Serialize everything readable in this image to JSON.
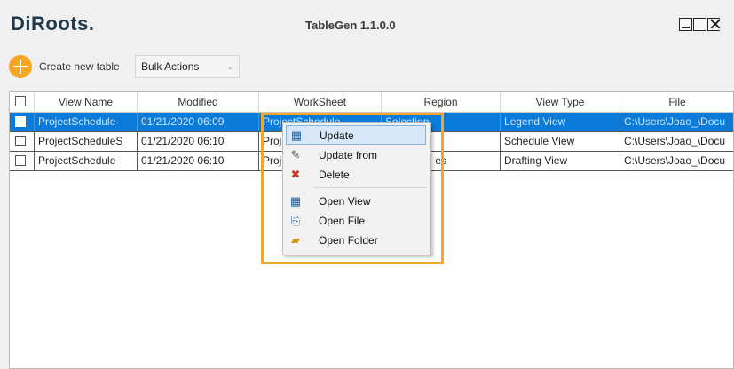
{
  "app": {
    "logo": "DiRoots.",
    "title": "TableGen 1.1.0.0"
  },
  "toolbar": {
    "create_label": "Create new table",
    "bulk_label": "Bulk Actions",
    "bulk_chevron": "⌄"
  },
  "table": {
    "headers": [
      "View Name",
      "Modified",
      "WorkSheet",
      "Region",
      "View Type",
      "File"
    ],
    "rows": [
      [
        "ProjectSchedule",
        "01/21/2020 06:09",
        "ProjectSchedule",
        "Selection",
        "Legend View",
        "C:\\Users\\Joao_\\Docu"
      ],
      [
        "ProjectScheduleS",
        "01/21/2020 06:10",
        "Proje",
        "",
        "Schedule View",
        "C:\\Users\\Joao_\\Docu"
      ],
      [
        "ProjectSchedule",
        "01/21/2020 06:10",
        "Proje",
        "es",
        "Drafting View",
        "C:\\Users\\Joao_\\Docu"
      ]
    ],
    "selected_row": 0
  },
  "context_menu": {
    "items": [
      {
        "label": "Update",
        "icon": "update-icon",
        "glyph": "▦"
      },
      {
        "label": "Update from",
        "icon": "pencil-icon",
        "glyph": "✎"
      },
      {
        "label": "Delete",
        "icon": "delete-table-icon",
        "glyph": "✖"
      },
      {
        "label": "Open View",
        "icon": "open-view-icon",
        "glyph": "▦"
      },
      {
        "label": "Open File",
        "icon": "open-file-icon",
        "glyph": "⎘"
      },
      {
        "label": "Open Folder",
        "icon": "folder-icon",
        "glyph": "▰"
      }
    ],
    "highlight_color": "#f5a623"
  },
  "colors": {
    "accent": "#f5a623",
    "selection": "#0a7bd9"
  }
}
